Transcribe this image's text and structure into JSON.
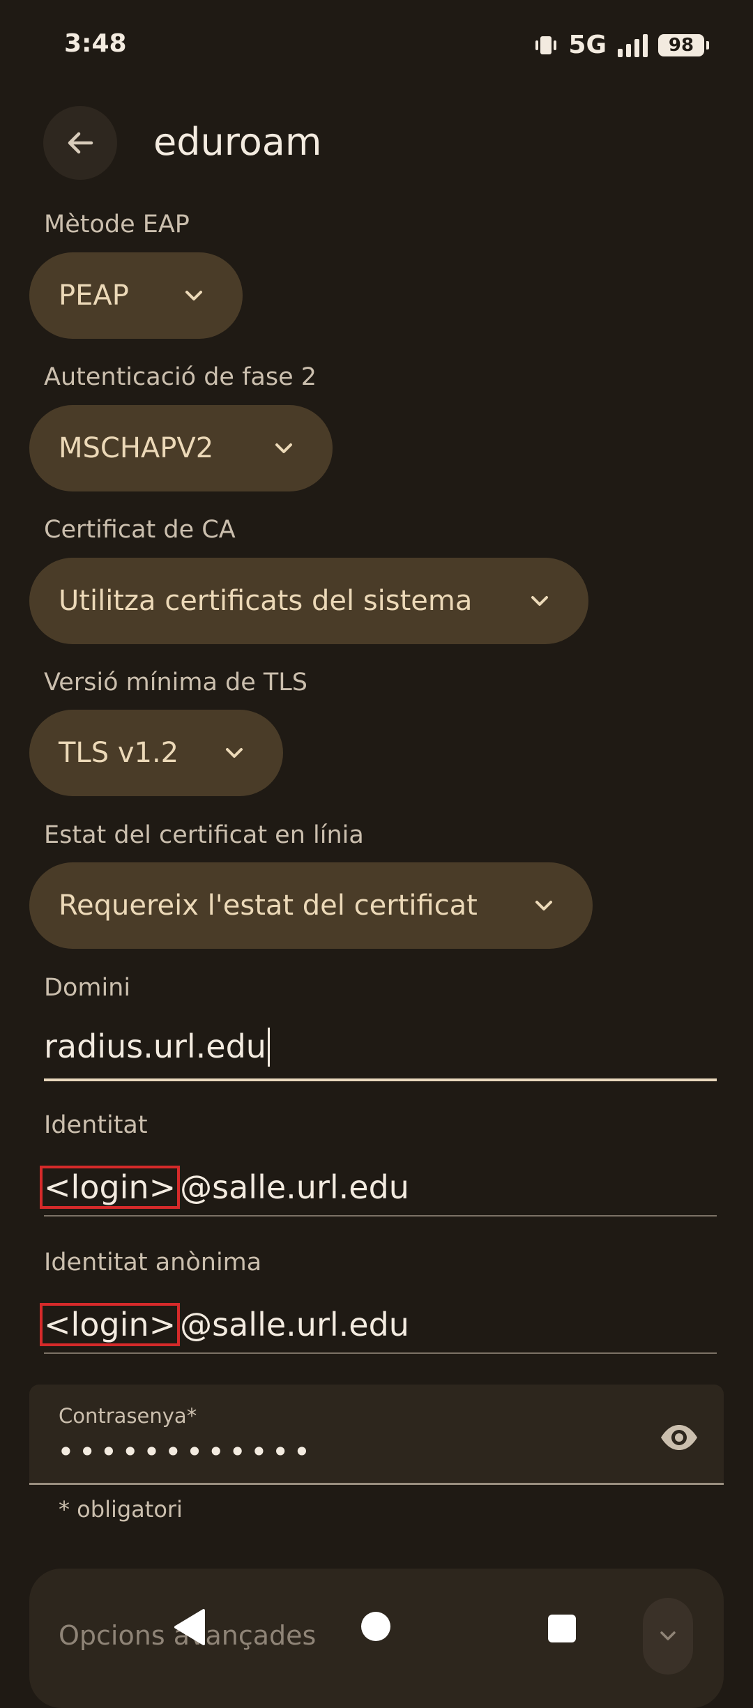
{
  "status_bar": {
    "time": "3:48",
    "network": "5G",
    "battery": "98"
  },
  "header": {
    "title": "eduroam"
  },
  "eap_method": {
    "label": "Mètode EAP",
    "value": "PEAP"
  },
  "phase2": {
    "label": "Autenticació de fase 2",
    "value": "MSCHAPV2"
  },
  "ca_cert": {
    "label": "Certificat de CA",
    "value": "Utilitza certificats del sistema"
  },
  "tls_min": {
    "label": "Versió mínima de TLS",
    "value": "TLS v1.2"
  },
  "cert_status": {
    "label": "Estat del certificat en línia",
    "value": "Requereix l'estat del certificat"
  },
  "domain": {
    "label": "Domini",
    "value": "radius.url.edu"
  },
  "identity": {
    "label": "Identitat",
    "login": "<login>",
    "suffix": "@salle.url.edu"
  },
  "anon_identity": {
    "label": "Identitat anònima",
    "login": "<login>",
    "suffix": "@salle.url.edu"
  },
  "password": {
    "label": "Contrasenya*",
    "masked": "••••••••••••"
  },
  "required_note": "* obligatori",
  "advanced": {
    "label": "Opcions avançades"
  },
  "colors": {
    "background": "#1f1a14",
    "pill": "#4a3c28",
    "highlight_box": "#d52a2a"
  }
}
